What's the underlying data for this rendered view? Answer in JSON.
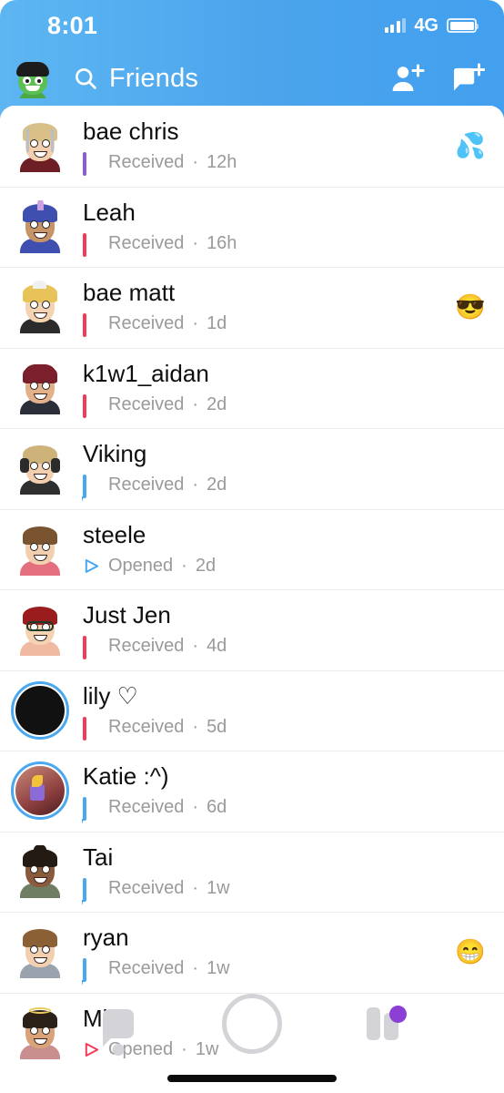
{
  "status_bar": {
    "time": "8:01",
    "network": "4G",
    "signal_icon": "cellular-bars-icon",
    "battery_icon": "battery-full-icon"
  },
  "header": {
    "avatar_icon": "profile-bitmoji-avatar",
    "search_icon": "search-icon",
    "title": "Friends",
    "add_friend_icon": "add-friend-icon",
    "new_chat_icon": "new-chat-icon"
  },
  "colors": {
    "brand_blue": "#4BA4EC",
    "status_purple": "#8A5CD8",
    "status_red": "#F23C57",
    "status_blue": "#4AA8F0",
    "badge_purple": "#8B3FD4"
  },
  "friends": [
    {
      "name": "bae chris",
      "status": "Received",
      "separator": "·",
      "time": "12h",
      "status_icon": "square-outline-icon",
      "status_color": "c-purple",
      "emoji": "💦",
      "emoji_name": "sweat-droplets-emoji",
      "story_ring": false
    },
    {
      "name": "Leah",
      "status": "Received",
      "separator": "·",
      "time": "16h",
      "status_icon": "square-outline-icon",
      "status_color": "c-red",
      "emoji": "",
      "emoji_name": "",
      "story_ring": false
    },
    {
      "name": "bae matt",
      "status": "Received",
      "separator": "·",
      "time": "1d",
      "status_icon": "square-outline-icon",
      "status_color": "c-red",
      "emoji": "😎",
      "emoji_name": "sunglasses-face-emoji",
      "story_ring": false
    },
    {
      "name": "k1w1_aidan",
      "status": "Received",
      "separator": "·",
      "time": "2d",
      "status_icon": "square-outline-icon",
      "status_color": "c-red",
      "emoji": "",
      "emoji_name": "",
      "story_ring": false
    },
    {
      "name": "Viking",
      "status": "Received",
      "separator": "·",
      "time": "2d",
      "status_icon": "chat-bubble-outline-icon",
      "status_color": "c-blue",
      "emoji": "",
      "emoji_name": "",
      "story_ring": false
    },
    {
      "name": "steele",
      "status": "Opened",
      "separator": "·",
      "time": "2d",
      "status_icon": "arrow-outline-icon",
      "status_color": "c-blue",
      "emoji": "",
      "emoji_name": "",
      "story_ring": false
    },
    {
      "name": "Just Jen",
      "status": "Received",
      "separator": "·",
      "time": "4d",
      "status_icon": "square-outline-icon",
      "status_color": "c-red",
      "emoji": "",
      "emoji_name": "",
      "story_ring": false
    },
    {
      "name": "lily ♡",
      "status": "Received",
      "separator": "·",
      "time": "5d",
      "status_icon": "square-outline-icon",
      "status_color": "c-red",
      "emoji": "",
      "emoji_name": "",
      "story_ring": true
    },
    {
      "name": "Katie :^)",
      "status": "Received",
      "separator": "·",
      "time": "6d",
      "status_icon": "chat-bubble-outline-icon",
      "status_color": "c-blue",
      "emoji": "",
      "emoji_name": "",
      "story_ring": true
    },
    {
      "name": "Tai",
      "status": "Received",
      "separator": "·",
      "time": "1w",
      "status_icon": "chat-bubble-outline-icon",
      "status_color": "c-blue",
      "emoji": "",
      "emoji_name": "",
      "story_ring": false
    },
    {
      "name": "ryan",
      "status": "Received",
      "separator": "·",
      "time": "1w",
      "status_icon": "chat-bubble-outline-icon",
      "status_color": "c-blue",
      "emoji": "😁",
      "emoji_name": "grinning-face-emoji",
      "story_ring": false
    },
    {
      "name": "Mike",
      "status": "Opened",
      "separator": "·",
      "time": "1w",
      "status_icon": "arrow-outline-icon",
      "status_color": "c-red",
      "emoji": "",
      "emoji_name": "",
      "story_ring": false
    }
  ],
  "bottom_nav": {
    "chat_icon": "chat-bubble-icon",
    "camera_icon": "camera-shutter-icon",
    "stories_icon": "stories-cards-icon",
    "stories_badge": "unread-stories-badge"
  }
}
